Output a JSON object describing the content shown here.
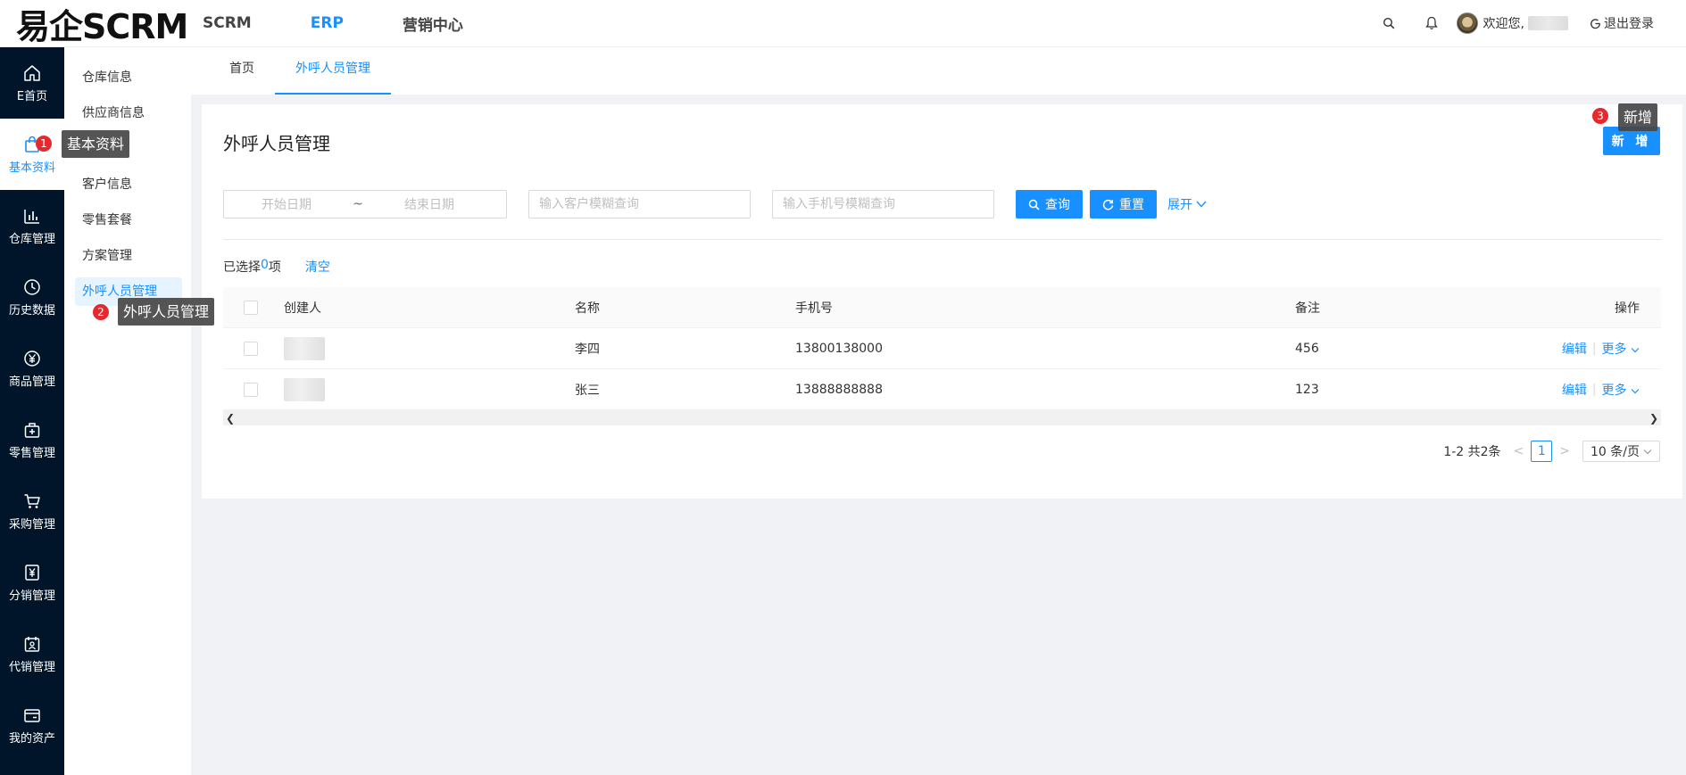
{
  "header": {
    "logo": "易企SCRM",
    "nav": [
      "SCRM",
      "ERP",
      "营销中心"
    ],
    "welcome": "欢迎您,",
    "logout": "退出登录"
  },
  "sidebar": [
    {
      "label": "E首页",
      "icon": "home-icon"
    },
    {
      "label": "基本资料",
      "icon": "shopping-bag-icon"
    },
    {
      "label": "仓库管理",
      "icon": "bar-chart-icon"
    },
    {
      "label": "历史数据",
      "icon": "clock-icon"
    },
    {
      "label": "商品管理",
      "icon": "yen-circle-icon"
    },
    {
      "label": "零售管理",
      "icon": "medical-box-icon"
    },
    {
      "label": "采购管理",
      "icon": "cart-icon"
    },
    {
      "label": "分销管理",
      "icon": "yen-box-icon"
    },
    {
      "label": "代销管理",
      "icon": "calendar-user-icon"
    },
    {
      "label": "我的资产",
      "icon": "wallet-icon"
    }
  ],
  "submenu": [
    "仓库信息",
    "供应商信息",
    "",
    "客户信息",
    "零售套餐",
    "方案管理",
    "外呼人员管理"
  ],
  "tabs": [
    "首页",
    "外呼人员管理"
  ],
  "page": {
    "title": "外呼人员管理",
    "add_label": "新 增",
    "date_start": "开始日期",
    "date_sep": "~",
    "date_end": "结束日期",
    "customer_placeholder": "输入客户模糊查询",
    "phone_placeholder": "输入手机号模糊查询",
    "search_label": "查询",
    "reset_label": "重置",
    "expand_label": "展开",
    "selected_prefix": "已选择 ",
    "selected_count": "0",
    "selected_suffix": "项",
    "clear_label": "清空"
  },
  "table": {
    "headers": [
      "创建人",
      "名称",
      "手机号",
      "备注",
      "操作"
    ],
    "rows": [
      {
        "name": "李四",
        "phone": "13800138000",
        "note": "456"
      },
      {
        "name": "张三",
        "phone": "13888888888",
        "note": "123"
      }
    ],
    "edit_label": "编辑",
    "more_label": "更多"
  },
  "pagination": {
    "total": "1-2 共2条",
    "current": "1",
    "page_size": "10 条/页"
  },
  "annotations": [
    {
      "num": "1",
      "text": "基本资料"
    },
    {
      "num": "2",
      "text": "外呼人员管理"
    },
    {
      "num": "3",
      "text": "新增"
    }
  ]
}
